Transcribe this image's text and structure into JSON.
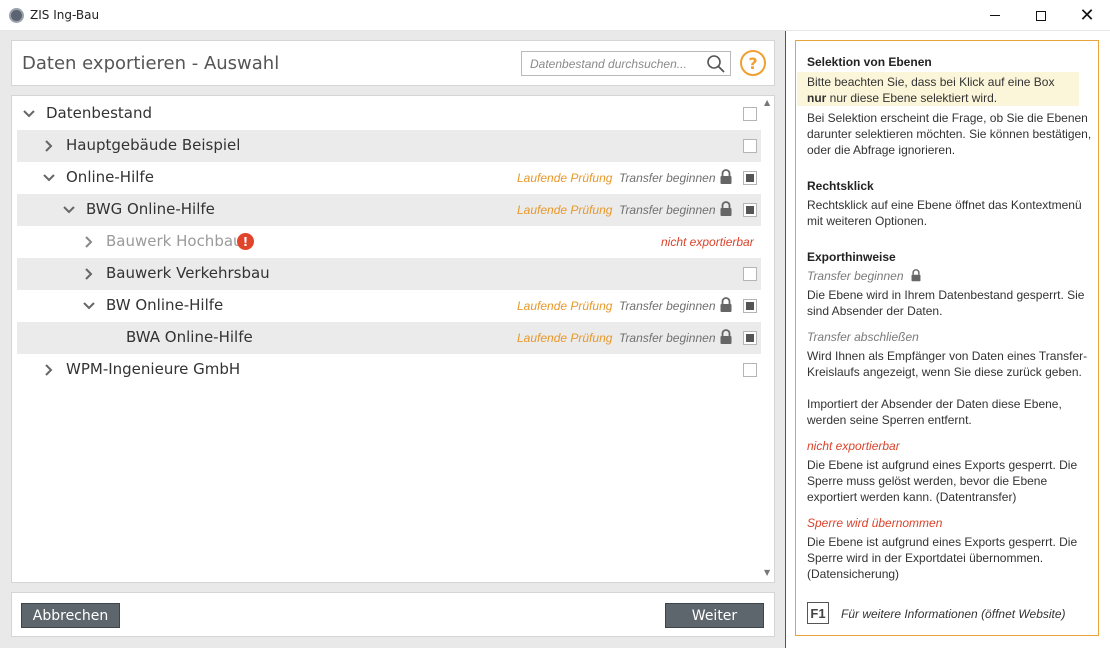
{
  "window": {
    "title": "ZIS Ing-Bau"
  },
  "header": {
    "title": "Daten exportieren - Auswahl",
    "search_placeholder": "Datenbestand durchsuchen...",
    "help": "?"
  },
  "tree": {
    "rows": [
      {
        "label": "Datenbestand",
        "expanded": true,
        "checked": false
      },
      {
        "label": "Hauptgebäude Beispiel",
        "expanded": false,
        "checked": false
      },
      {
        "label": "Online-Hilfe",
        "expanded": true,
        "checked": true,
        "status": "Laufende Prüfung",
        "action": "Transfer beginnen"
      },
      {
        "label": "BWG Online-Hilfe",
        "expanded": true,
        "checked": true,
        "status": "Laufende Prüfung",
        "action": "Transfer beginnen"
      },
      {
        "label": "Bauwerk Hochbau",
        "expanded": false,
        "disabled": true,
        "note": "nicht exportierbar",
        "warning": "!"
      },
      {
        "label": "Bauwerk Verkehrsbau",
        "expanded": false,
        "checked": false
      },
      {
        "label": "BW Online-Hilfe",
        "expanded": true,
        "checked": true,
        "status": "Laufende Prüfung",
        "action": "Transfer beginnen"
      },
      {
        "label": "BWA Online-Hilfe",
        "checked": true,
        "status": "Laufende Prüfung",
        "action": "Transfer beginnen"
      },
      {
        "label": "WPM-Ingenieure GmbH",
        "expanded": false,
        "checked": false
      }
    ]
  },
  "footer": {
    "cancel_label": "Abbrechen",
    "next_label": "Weiter"
  },
  "info": {
    "selection_title": "Selektion von Ebenen",
    "selection_hl_1": "Bitte beachten Sie, dass bei Klick auf eine Box",
    "selection_hl_bold": "nur",
    "selection_hl_2": " nur diese Ebene selektiert wird.",
    "selection_text": "Bei Selektion erscheint die Frage, ob Sie die Ebenen darunter selektieren möchten. Sie können bestätigen, oder die Abfrage ignorieren.",
    "rightclick_title": "Rechtsklick",
    "rightclick_text": "Rechtsklick auf eine Ebene öffnet das Kontextmenü mit weiteren Optionen.",
    "export_title": "Exporthinweise",
    "transfer_begin": "Transfer beginnen",
    "transfer_begin_text": "Die Ebene wird in Ihrem Datenbestand gesperrt. Sie sind Absender der Daten.",
    "transfer_end": "Transfer abschließen",
    "transfer_end_text": "Wird Ihnen als Empfänger von Daten eines Transfer-Kreislaufs angezeigt, wenn Sie diese zurück geben.",
    "import_text": "Importiert der Absender der Daten diese Ebene, werden seine Sperren entfernt.",
    "not_exportable": "nicht exportierbar",
    "not_exportable_text": "Die Ebene ist aufgrund eines Exports gesperrt. Die Sperre muss gelöst werden, bevor die Ebene exportiert werden kann. (Datentransfer)",
    "lock_taken": "Sperre wird übernommen",
    "lock_taken_text": "Die Ebene ist aufgrund eines Exports gesperrt. Die Sperre wird in der Exportdatei übernommen. (Datensicherung)",
    "f1_key": "F1",
    "f1_text": "Für weitere Informationen (öffnet Website)"
  },
  "colors": {
    "accent": "#f0a030",
    "warning": "#d9432b",
    "button": "#5d666d"
  },
  "icons": {
    "search": "search-icon",
    "help": "help-icon",
    "lock": "lock-icon",
    "chevron_right": "chevron-right-icon",
    "chevron_down": "chevron-down-icon",
    "warning": "warning-icon"
  }
}
